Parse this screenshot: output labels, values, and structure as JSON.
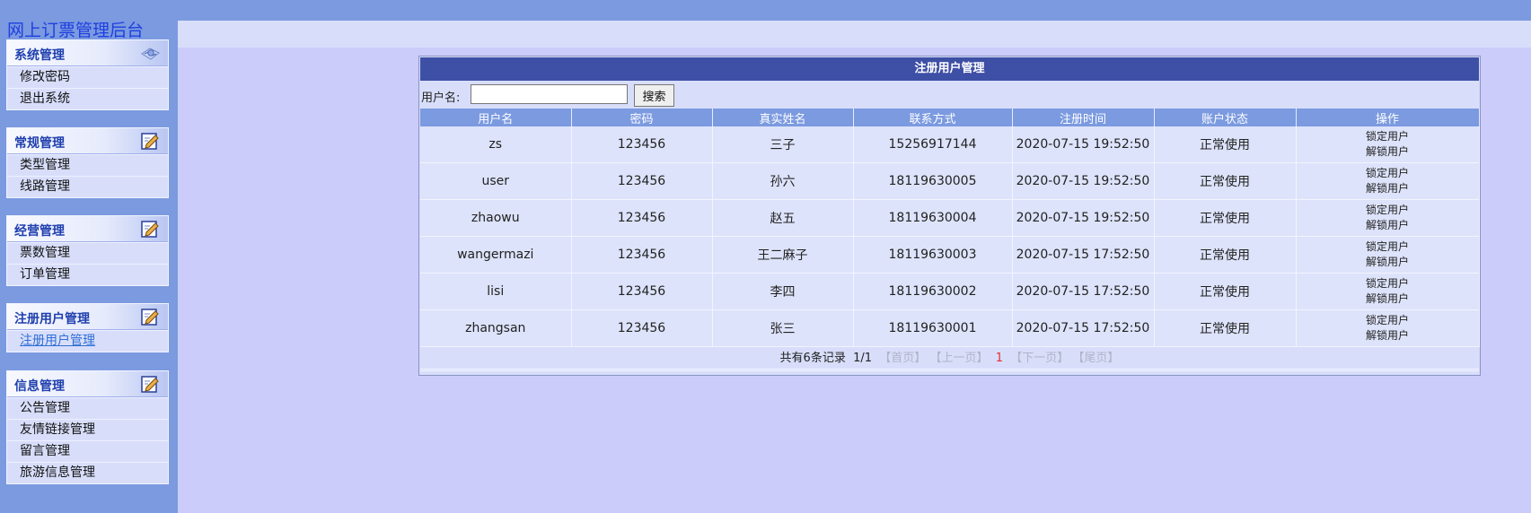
{
  "app_title": "网上订票管理后台",
  "sidebar": {
    "groups": [
      {
        "title": "系统管理",
        "icon": "settings-icon",
        "items": [
          "修改密码",
          "退出系统"
        ]
      },
      {
        "title": "常规管理",
        "icon": "edit-icon",
        "items": [
          "类型管理",
          "线路管理"
        ]
      },
      {
        "title": "经营管理",
        "icon": "edit-icon",
        "items": [
          "票数管理",
          "订单管理"
        ]
      },
      {
        "title": "注册用户管理",
        "icon": "edit-icon",
        "items": [
          "注册用户管理"
        ],
        "active_item": "注册用户管理"
      },
      {
        "title": "信息管理",
        "icon": "edit-icon",
        "items": [
          "公告管理",
          "友情链接管理",
          "留言管理",
          "旅游信息管理"
        ]
      }
    ]
  },
  "panel": {
    "title": "注册用户管理",
    "search": {
      "label": "用户名:",
      "value": "",
      "placeholder": "",
      "button": "搜索"
    },
    "columns": [
      "用户名",
      "密码",
      "真实姓名",
      "联系方式",
      "注册时间",
      "账户状态",
      "操作"
    ],
    "rows": [
      {
        "username": "zs",
        "password": "123456",
        "realname": "三子",
        "phone": "15256917144",
        "time": "2020-07-15 19:52:50",
        "status": "正常使用",
        "lock": "锁定用户",
        "unlock": "解锁用户"
      },
      {
        "username": "user",
        "password": "123456",
        "realname": "孙六",
        "phone": "18119630005",
        "time": "2020-07-15 19:52:50",
        "status": "正常使用",
        "lock": "锁定用户",
        "unlock": "解锁用户"
      },
      {
        "username": "zhaowu",
        "password": "123456",
        "realname": "赵五",
        "phone": "18119630004",
        "time": "2020-07-15 19:52:50",
        "status": "正常使用",
        "lock": "锁定用户",
        "unlock": "解锁用户"
      },
      {
        "username": "wangermazi",
        "password": "123456",
        "realname": "王二麻子",
        "phone": "18119630003",
        "time": "2020-07-15 17:52:50",
        "status": "正常使用",
        "lock": "锁定用户",
        "unlock": "解锁用户"
      },
      {
        "username": "lisi",
        "password": "123456",
        "realname": "李四",
        "phone": "18119630002",
        "time": "2020-07-15 17:52:50",
        "status": "正常使用",
        "lock": "锁定用户",
        "unlock": "解锁用户"
      },
      {
        "username": "zhangsan",
        "password": "123456",
        "realname": "张三",
        "phone": "18119630001",
        "time": "2020-07-15 17:52:50",
        "status": "正常使用",
        "lock": "锁定用户",
        "unlock": "解锁用户"
      }
    ],
    "pager": {
      "total": "共有6条记录",
      "page": "1/1",
      "first": "【首页】",
      "prev": "【上一页】",
      "current": "1",
      "next": "【下一页】",
      "last": "【尾页】"
    }
  },
  "colors": {
    "sidebar_bg": "#7b9ae0",
    "header_bar": "#3e4fa6",
    "page_bg": "#ccccfb",
    "current_page": "#e03030"
  }
}
